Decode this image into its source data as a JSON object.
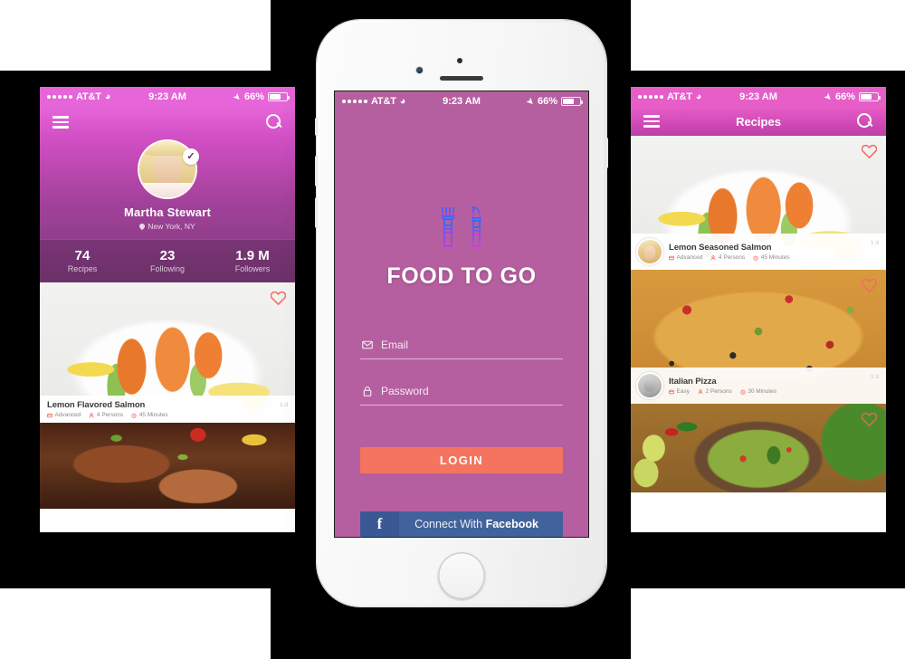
{
  "status_bar": {
    "carrier": "AT&T",
    "time": "9:23 AM",
    "battery": "66%",
    "signal_dots": 5
  },
  "left_phone": {
    "nav": {
      "menu_icon": "hamburger-icon",
      "search_icon": "search-icon"
    },
    "profile": {
      "name": "Martha Stewart",
      "location": "New York, NY",
      "verified": "✓",
      "stats": [
        {
          "value": "74",
          "label": "Recipes"
        },
        {
          "value": "23",
          "label": "Following"
        },
        {
          "value": "1.9 M",
          "label": "Followers"
        }
      ]
    },
    "cards": [
      {
        "title": "Lemon Flavored Salmon",
        "time_ago": "1 d",
        "difficulty": "Advanced",
        "persons": "4 Persons",
        "duration": "45 Minutes",
        "image": "grilled-salmon-plate"
      },
      {
        "title": "",
        "image": "grilled-steak"
      }
    ]
  },
  "center_phone": {
    "login": {
      "logo_icon": "fork-and-knife-icon",
      "brand": "FOOD TO GO",
      "email_placeholder": "Email",
      "password_placeholder": "Password",
      "email_value": "",
      "password_value": "",
      "login_label": "LOGIN",
      "facebook_prefix": "Connect With ",
      "facebook_brand": "Facebook",
      "facebook_glyph": "f"
    },
    "colors": {
      "login_button": "#f4745f",
      "facebook_button": "#41629b",
      "facebook_icon_bg": "#3a5894"
    }
  },
  "right_phone": {
    "nav": {
      "title": "Recipes",
      "menu_icon": "hamburger-icon",
      "search_icon": "search-icon"
    },
    "cards": [
      {
        "title": "Lemon Seasoned Salmon",
        "time_ago": "1 d",
        "difficulty": "Advanced",
        "persons": "4 Persons",
        "duration": "45 Minutes",
        "author_avatar": "woman",
        "image": "grilled-salmon-plate"
      },
      {
        "title": "Italian Pizza",
        "time_ago": "1 d",
        "difficulty": "Easy",
        "persons": "2 Persons",
        "duration": "30 Minutes",
        "author_avatar": "man",
        "image": "italian-pizza"
      },
      {
        "title": "",
        "image": "guacamole-bowl"
      }
    ]
  },
  "theme": {
    "header_pink": "#e665d8",
    "header_purple": "#7c3b78",
    "heart_color": "#ef6f61",
    "backdrop": "#000000"
  }
}
